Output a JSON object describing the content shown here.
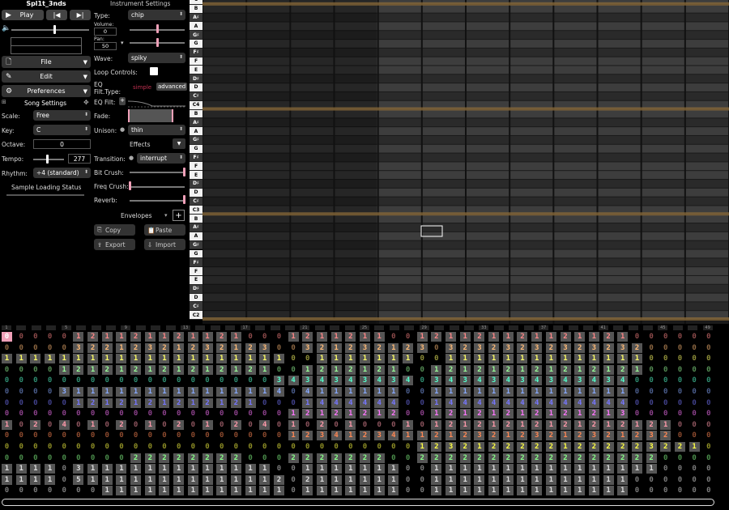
{
  "song": {
    "title": "Spl1t_3nds"
  },
  "transport": {
    "play_label": "Play"
  },
  "menus": {
    "file": "File",
    "edit": "Edit",
    "preferences": "Preferences"
  },
  "song_settings": {
    "title": "Song Settings",
    "scale_label": "Scale:",
    "scale_value": "Free",
    "key_label": "Key:",
    "key_value": "C",
    "octave_label": "Octave:",
    "octave_value": "0",
    "tempo_label": "Tempo:",
    "tempo_value": "277",
    "tempo_level": 0.45,
    "rhythm_label": "Rhythm:",
    "rhythm_value": "÷4 (standard)",
    "sample_status": "Sample Loading Status"
  },
  "instrument": {
    "title": "Instrument Settings",
    "type_label": "Type:",
    "type_value": "chip",
    "volume_label": "Volume:",
    "volume_value": "0",
    "pan_label": "Pan:",
    "pan_value": "50",
    "wave_label": "Wave:",
    "wave_value": "spiky",
    "loop_label": "Loop Controls:",
    "eq_type_label": "EQ Filt.Type:",
    "eq_simple": "simple",
    "eq_advanced": "advanced",
    "eq_filt_label": "EQ Filt:",
    "eq_plus": "+",
    "fade_label": "Fade:",
    "unison_label": "Unison:",
    "unison_value": "thin",
    "effects_label": "Effects",
    "transition_label": "Transition:",
    "transition_value": "interrupt",
    "bitcrush_label": "Bit Crush:",
    "freqcrush_label": "Freq Crush:",
    "reverb_label": "Reverb:",
    "envelopes_label": "Envelopes",
    "envelopes_plus": "+",
    "copy_label": "Copy",
    "paste_label": "Paste",
    "export_label": "Export",
    "import_label": "Import"
  },
  "piano_keys": [
    "C",
    "B",
    "A♯",
    "A",
    "G♯",
    "G",
    "F♯",
    "F",
    "E",
    "D♯",
    "D",
    "C♯",
    "C4",
    "B",
    "A♯",
    "A",
    "G♯",
    "G",
    "F♯",
    "F",
    "E",
    "D♯",
    "D",
    "C♯",
    "C3",
    "B",
    "A♯",
    "A",
    "G♯",
    "G",
    "F♯",
    "F",
    "E",
    "D♯",
    "D",
    "C♯",
    "C2"
  ],
  "bar_numbers": [
    "1",
    "",
    "",
    "",
    "5",
    "",
    "",
    "",
    "9",
    "",
    "",
    "",
    "13",
    "",
    "",
    "",
    "17",
    "",
    "",
    "",
    "21",
    "",
    "",
    "",
    "25",
    "",
    "",
    "",
    "29",
    "",
    "",
    "",
    "33",
    "",
    "",
    "",
    "37",
    "",
    "",
    "",
    "41",
    "",
    "",
    "",
    "45",
    "",
    "",
    "49"
  ],
  "colors": {
    "row_colors": [
      "#ff8888",
      "#ffbb77",
      "#ffff66",
      "#99ff99",
      "#55ffcc",
      "#88aaff",
      "#7777ff",
      "#ff77ff",
      "#ff99aa",
      "#ff8855",
      "#ffff44",
      "#88ff88",
      "#dddddd",
      "#dddddd",
      "#dddddd"
    ],
    "accent": "#f0a0b8",
    "grid_line": "#8b6b3a"
  },
  "pattern_rows": [
    "00000121121121121000121121100121121121121121000000",
    "00000322123212321230032123212303232323232323200000",
    "11111111111111111111001111111001111111111111100000",
    "00001212121212121210012121210012121212121212100000",
    "00000000000000000003434343434034343434343434000000",
    "00003111111111111114041111110011111111111111000000",
    "00000121212121212100014444440014444444444444000000",
    "00000000000000000000121212120012121212121213000000",
    "10204010201020102040102010001012121212121212121000",
    "00000000000000000000123412341121232123212321232000",
    "00000000000000000000000000000123212222212222232210",
    "00000000022222222000222222200222222222222222220000",
    "11110311111111111110011111110011111111111111110000",
    "11110511111111111112021111110011111111111111000000",
    "00000001111111111111011111110011111111111111000000"
  ]
}
